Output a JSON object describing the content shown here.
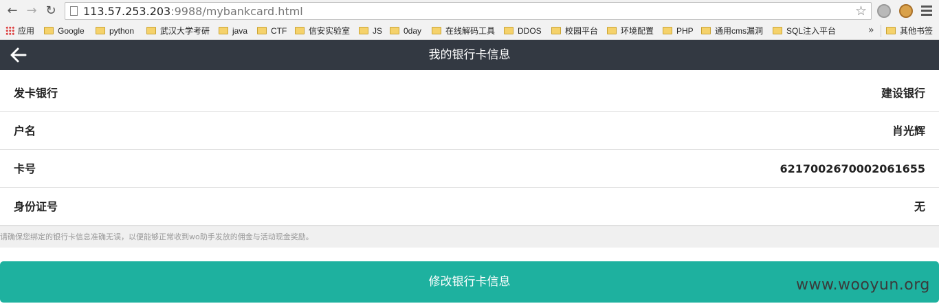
{
  "browser": {
    "url_host": "113.57.253.203",
    "url_rest": ":9988/mybankcard.html",
    "bookmarks": [
      "应用",
      "Google",
      "python",
      "武汉大学考研",
      "java",
      "CTF",
      "信安实验室",
      "JS",
      "0day",
      "在线解码工具",
      "DDOS",
      "校园平台",
      "环境配置",
      "PHP",
      "通用cms漏洞",
      "SQL注入平台"
    ],
    "overflow": "»",
    "other_bookmarks": "其他书签"
  },
  "header": {
    "title": "我的银行卡信息"
  },
  "card_info": [
    {
      "label": "发卡银行",
      "value": "建设银行"
    },
    {
      "label": "户名",
      "value": "肖光辉"
    },
    {
      "label": "卡号",
      "value": "6217002670002061655"
    },
    {
      "label": "身份证号",
      "value": "无"
    }
  ],
  "notice": "请确保您绑定的银行卡信息准确无误，以便能够正常收到wo助手发放的佣金与活动现金奖励。",
  "submit_label": "修改银行卡信息",
  "watermark": "www.wooyun.org",
  "colors": {
    "header_bg": "#333942",
    "button_bg": "#1eb19f"
  }
}
